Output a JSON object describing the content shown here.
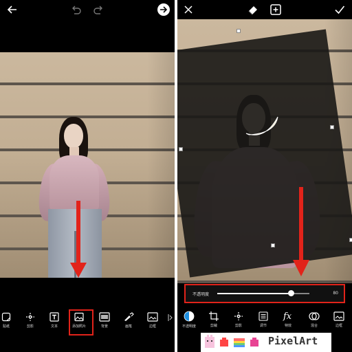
{
  "left": {
    "toolbar": {
      "items": [
        {
          "label": "贴纸",
          "icon": "sticker-icon"
        },
        {
          "label": "剪影",
          "icon": "cutout-icon"
        },
        {
          "label": "文本",
          "icon": "text-icon"
        },
        {
          "label": "添加照片",
          "icon": "add-photo-icon",
          "highlighted": true
        },
        {
          "label": "背景",
          "icon": "background-icon"
        },
        {
          "label": "画笔",
          "icon": "brush-icon"
        },
        {
          "label": "边框",
          "icon": "frame-icon"
        }
      ]
    }
  },
  "right": {
    "slider": {
      "label": "不透明度",
      "value": "80",
      "fraction": 0.8
    },
    "toolbar": {
      "items": [
        {
          "label": "不透明度",
          "icon": "opacity-icon",
          "active": true
        },
        {
          "label": "剪裁",
          "icon": "crop-icon"
        },
        {
          "label": "剪影",
          "icon": "cutout-icon"
        },
        {
          "label": "调节",
          "icon": "adjust-icon"
        },
        {
          "label": "特效",
          "icon": "fx-icon"
        },
        {
          "label": "混合",
          "icon": "blend-icon"
        },
        {
          "label": "边框",
          "icon": "frame-icon"
        }
      ]
    },
    "ad": {
      "text": "PixelArt"
    }
  },
  "colors": {
    "annotation_red": "#e2231a",
    "background": "#000000"
  }
}
